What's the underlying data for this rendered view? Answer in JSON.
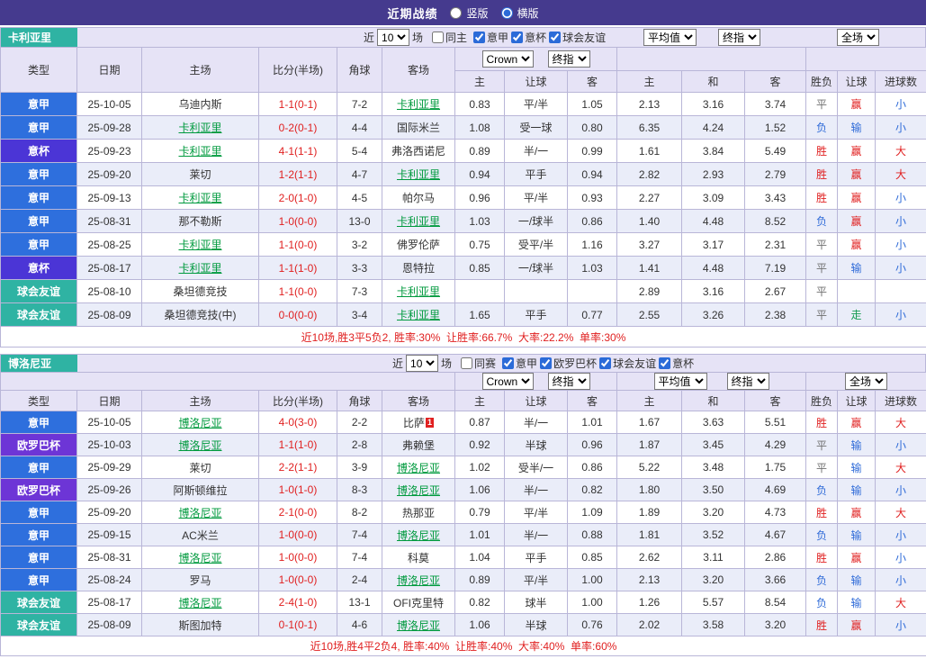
{
  "topbar": {
    "title": "近期战绩",
    "vertical_label": "竖版",
    "horizontal_label": "横版",
    "vertical_checked": false,
    "horizontal_checked": true,
    "selected": "横版"
  },
  "colors": {
    "topbar_bg": "#453a8e",
    "team_bar": "#2fb3a3",
    "header_bg": "#e6e3f6",
    "row_alt": "#eaedf9",
    "border": "#b9b6d8",
    "score": "#e02020",
    "red_card": "#e02020",
    "self_team": "#009a3e",
    "summary": "#e02020",
    "league": {
      "意甲": "#2e6fdd",
      "意杯": "#4b35d6",
      "球会友谊": "#2fb3a3",
      "欧罗巴杯": "#6d35d6"
    },
    "results": {
      "胜": "#e02020",
      "平": "#6f6f6f",
      "负": "#2f6bd8",
      "赢": "#e02020",
      "输": "#2f6bd8",
      "走": "#149b50",
      "大": "#e02020",
      "小": "#2f6bd8"
    }
  },
  "sections": [
    {
      "team": "卡利亚里",
      "filters": {
        "near": "近",
        "count": "10",
        "unit": "场",
        "same": {
          "label": "同主",
          "checked": false
        },
        "comps": [
          {
            "label": "意甲",
            "checked": true
          },
          {
            "label": "意杯",
            "checked": true
          },
          {
            "label": "球会友谊",
            "checked": true
          }
        ]
      },
      "dropdowns": {
        "company": "Crown",
        "company_stage": "终指",
        "euro": "平均值",
        "euro_stage": "终指",
        "scope": "全场"
      },
      "header": {
        "type": "类型",
        "date": "日期",
        "home": "主场",
        "score": "比分(半场)",
        "corner": "角球",
        "away": "客场",
        "asian": {
          "home": "主",
          "hcp": "让球",
          "away": "客"
        },
        "euro": {
          "home": "主",
          "draw": "和",
          "away": "客"
        },
        "result": {
          "wdl": "胜负",
          "hcp": "让球",
          "goals": "进球数"
        }
      },
      "rows": [
        {
          "league": "意甲",
          "date": "25-10-05",
          "home": "乌迪内斯",
          "home_self": false,
          "score": "1-1(0-1)",
          "corner": "7-2",
          "away": "卡利亚里",
          "away_self": true,
          "asian": [
            "0.83",
            "平/半",
            "1.05"
          ],
          "euro": [
            "2.13",
            "3.16",
            "3.74"
          ],
          "wdl": "平",
          "hcp": "赢",
          "goals": "小"
        },
        {
          "league": "意甲",
          "date": "25-09-28",
          "home": "卡利亚里",
          "home_self": true,
          "score": "0-2(0-1)",
          "corner": "4-4",
          "away": "国际米兰",
          "away_self": false,
          "asian": [
            "1.08",
            "受一球",
            "0.80"
          ],
          "euro": [
            "6.35",
            "4.24",
            "1.52"
          ],
          "wdl": "负",
          "hcp": "输",
          "goals": "小"
        },
        {
          "league": "意杯",
          "date": "25-09-23",
          "home": "卡利亚里",
          "home_self": true,
          "score": "4-1(1-1)",
          "corner": "5-4",
          "away": "弗洛西诺尼",
          "away_self": false,
          "asian": [
            "0.89",
            "半/一",
            "0.99"
          ],
          "euro": [
            "1.61",
            "3.84",
            "5.49"
          ],
          "wdl": "胜",
          "hcp": "赢",
          "goals": "大"
        },
        {
          "league": "意甲",
          "date": "25-09-20",
          "home": "莱切",
          "home_self": false,
          "score": "1-2(1-1)",
          "corner": "4-7",
          "away": "卡利亚里",
          "away_self": true,
          "asian": [
            "0.94",
            "平手",
            "0.94"
          ],
          "euro": [
            "2.82",
            "2.93",
            "2.79"
          ],
          "wdl": "胜",
          "hcp": "赢",
          "goals": "大"
        },
        {
          "league": "意甲",
          "date": "25-09-13",
          "home": "卡利亚里",
          "home_self": true,
          "score": "2-0(1-0)",
          "corner": "4-5",
          "away": "帕尔马",
          "away_self": false,
          "asian": [
            "0.96",
            "平/半",
            "0.93"
          ],
          "euro": [
            "2.27",
            "3.09",
            "3.43"
          ],
          "wdl": "胜",
          "hcp": "赢",
          "goals": "小"
        },
        {
          "league": "意甲",
          "date": "25-08-31",
          "home": "那不勒斯",
          "home_self": false,
          "score": "1-0(0-0)",
          "corner": "13-0",
          "away": "卡利亚里",
          "away_self": true,
          "asian": [
            "1.03",
            "一/球半",
            "0.86"
          ],
          "euro": [
            "1.40",
            "4.48",
            "8.52"
          ],
          "wdl": "负",
          "hcp": "赢",
          "goals": "小"
        },
        {
          "league": "意甲",
          "date": "25-08-25",
          "home": "卡利亚里",
          "home_self": true,
          "score": "1-1(0-0)",
          "corner": "3-2",
          "away": "佛罗伦萨",
          "away_self": false,
          "asian": [
            "0.75",
            "受平/半",
            "1.16"
          ],
          "euro": [
            "3.27",
            "3.17",
            "2.31"
          ],
          "wdl": "平",
          "hcp": "赢",
          "goals": "小"
        },
        {
          "league": "意杯",
          "date": "25-08-17",
          "home": "卡利亚里",
          "home_self": true,
          "score": "1-1(1-0)",
          "corner": "3-3",
          "away": "恩特拉",
          "away_self": false,
          "asian": [
            "0.85",
            "一/球半",
            "1.03"
          ],
          "euro": [
            "1.41",
            "4.48",
            "7.19"
          ],
          "wdl": "平",
          "hcp": "输",
          "goals": "小"
        },
        {
          "league": "球会友谊",
          "date": "25-08-10",
          "home": "桑坦德竞技",
          "home_self": false,
          "score": "1-1(0-0)",
          "corner": "7-3",
          "away": "卡利亚里",
          "away_self": true,
          "asian": [
            "",
            "",
            ""
          ],
          "euro": [
            "2.89",
            "3.16",
            "2.67"
          ],
          "wdl": "平",
          "hcp": "",
          "goals": ""
        },
        {
          "league": "球会友谊",
          "date": "25-08-09",
          "home": "桑坦德竞技(中)",
          "home_self": false,
          "score": "0-0(0-0)",
          "corner": "3-4",
          "away": "卡利亚里",
          "away_self": true,
          "asian": [
            "1.65",
            "平手",
            "0.77"
          ],
          "euro": [
            "2.55",
            "3.26",
            "2.38"
          ],
          "wdl": "平",
          "hcp": "走",
          "goals": "小"
        }
      ],
      "summary": "近10场,胜3平5负2, 胜率:30%  让胜率:66.7%  大率:22.2%  单率:30%"
    },
    {
      "team": "博洛尼亚",
      "filters": {
        "near": "近",
        "count": "10",
        "unit": "场",
        "same": {
          "label": "同赛",
          "checked": false
        },
        "comps": [
          {
            "label": "意甲",
            "checked": true
          },
          {
            "label": "欧罗巴杯",
            "checked": true
          },
          {
            "label": "球会友谊",
            "checked": true
          },
          {
            "label": "意杯",
            "checked": true
          }
        ]
      },
      "dropdowns": {
        "company": "Crown",
        "company_stage": "终指",
        "euro": "平均值",
        "euro_stage": "终指",
        "scope": "全场"
      },
      "header": {
        "type": "类型",
        "date": "日期",
        "home": "主场",
        "score": "比分(半场)",
        "corner": "角球",
        "away": "客场",
        "asian": {
          "home": "主",
          "hcp": "让球",
          "away": "客"
        },
        "euro": {
          "home": "主",
          "draw": "和",
          "away": "客"
        },
        "result": {
          "wdl": "胜负",
          "hcp": "让球",
          "goals": "进球数"
        }
      },
      "rows": [
        {
          "league": "意甲",
          "date": "25-10-05",
          "home": "博洛尼亚",
          "home_self": true,
          "score": "4-0(3-0)",
          "corner": "2-2",
          "away": "比萨",
          "away_self": false,
          "away_badge": "1",
          "asian": [
            "0.87",
            "半/一",
            "1.01"
          ],
          "euro": [
            "1.67",
            "3.63",
            "5.51"
          ],
          "wdl": "胜",
          "hcp": "赢",
          "goals": "大"
        },
        {
          "league": "欧罗巴杯",
          "date": "25-10-03",
          "home": "博洛尼亚",
          "home_self": true,
          "score": "1-1(1-0)",
          "corner": "2-8",
          "away": "弗赖堡",
          "away_self": false,
          "asian": [
            "0.92",
            "半球",
            "0.96"
          ],
          "euro": [
            "1.87",
            "3.45",
            "4.29"
          ],
          "wdl": "平",
          "hcp": "输",
          "goals": "小"
        },
        {
          "league": "意甲",
          "date": "25-09-29",
          "home": "莱切",
          "home_self": false,
          "score": "2-2(1-1)",
          "corner": "3-9",
          "away": "博洛尼亚",
          "away_self": true,
          "asian": [
            "1.02",
            "受半/一",
            "0.86"
          ],
          "euro": [
            "5.22",
            "3.48",
            "1.75"
          ],
          "wdl": "平",
          "hcp": "输",
          "goals": "大"
        },
        {
          "league": "欧罗巴杯",
          "date": "25-09-26",
          "home": "阿斯顿维拉",
          "home_self": false,
          "score": "1-0(1-0)",
          "corner": "8-3",
          "away": "博洛尼亚",
          "away_self": true,
          "asian": [
            "1.06",
            "半/一",
            "0.82"
          ],
          "euro": [
            "1.80",
            "3.50",
            "4.69"
          ],
          "wdl": "负",
          "hcp": "输",
          "goals": "小"
        },
        {
          "league": "意甲",
          "date": "25-09-20",
          "home": "博洛尼亚",
          "home_self": true,
          "score": "2-1(0-0)",
          "corner": "8-2",
          "away": "热那亚",
          "away_self": false,
          "asian": [
            "0.79",
            "平/半",
            "1.09"
          ],
          "euro": [
            "1.89",
            "3.20",
            "4.73"
          ],
          "wdl": "胜",
          "hcp": "赢",
          "goals": "大"
        },
        {
          "league": "意甲",
          "date": "25-09-15",
          "home": "AC米兰",
          "home_self": false,
          "score": "1-0(0-0)",
          "corner": "7-4",
          "away": "博洛尼亚",
          "away_self": true,
          "asian": [
            "1.01",
            "半/一",
            "0.88"
          ],
          "euro": [
            "1.81",
            "3.52",
            "4.67"
          ],
          "wdl": "负",
          "hcp": "输",
          "goals": "小"
        },
        {
          "league": "意甲",
          "date": "25-08-31",
          "home": "博洛尼亚",
          "home_self": true,
          "score": "1-0(0-0)",
          "corner": "7-4",
          "away": "科莫",
          "away_self": false,
          "asian": [
            "1.04",
            "平手",
            "0.85"
          ],
          "euro": [
            "2.62",
            "3.11",
            "2.86"
          ],
          "wdl": "胜",
          "hcp": "赢",
          "goals": "小"
        },
        {
          "league": "意甲",
          "date": "25-08-24",
          "home": "罗马",
          "home_self": false,
          "score": "1-0(0-0)",
          "corner": "2-4",
          "away": "博洛尼亚",
          "away_self": true,
          "asian": [
            "0.89",
            "平/半",
            "1.00"
          ],
          "euro": [
            "2.13",
            "3.20",
            "3.66"
          ],
          "wdl": "负",
          "hcp": "输",
          "goals": "小"
        },
        {
          "league": "球会友谊",
          "date": "25-08-17",
          "home": "博洛尼亚",
          "home_self": true,
          "score": "2-4(1-0)",
          "corner": "13-1",
          "away": "OFI克里特",
          "away_self": false,
          "asian": [
            "0.82",
            "球半",
            "1.00"
          ],
          "euro": [
            "1.26",
            "5.57",
            "8.54"
          ],
          "wdl": "负",
          "hcp": "输",
          "goals": "大"
        },
        {
          "league": "球会友谊",
          "date": "25-08-09",
          "home": "斯图加特",
          "home_self": false,
          "score": "0-1(0-1)",
          "corner": "4-6",
          "away": "博洛尼亚",
          "away_self": true,
          "asian": [
            "1.06",
            "半球",
            "0.76"
          ],
          "euro": [
            "2.02",
            "3.58",
            "3.20"
          ],
          "wdl": "胜",
          "hcp": "赢",
          "goals": "小"
        }
      ],
      "summary": "近10场,胜4平2负4, 胜率:40%  让胜率:40%  大率:40%  单率:60%"
    }
  ]
}
